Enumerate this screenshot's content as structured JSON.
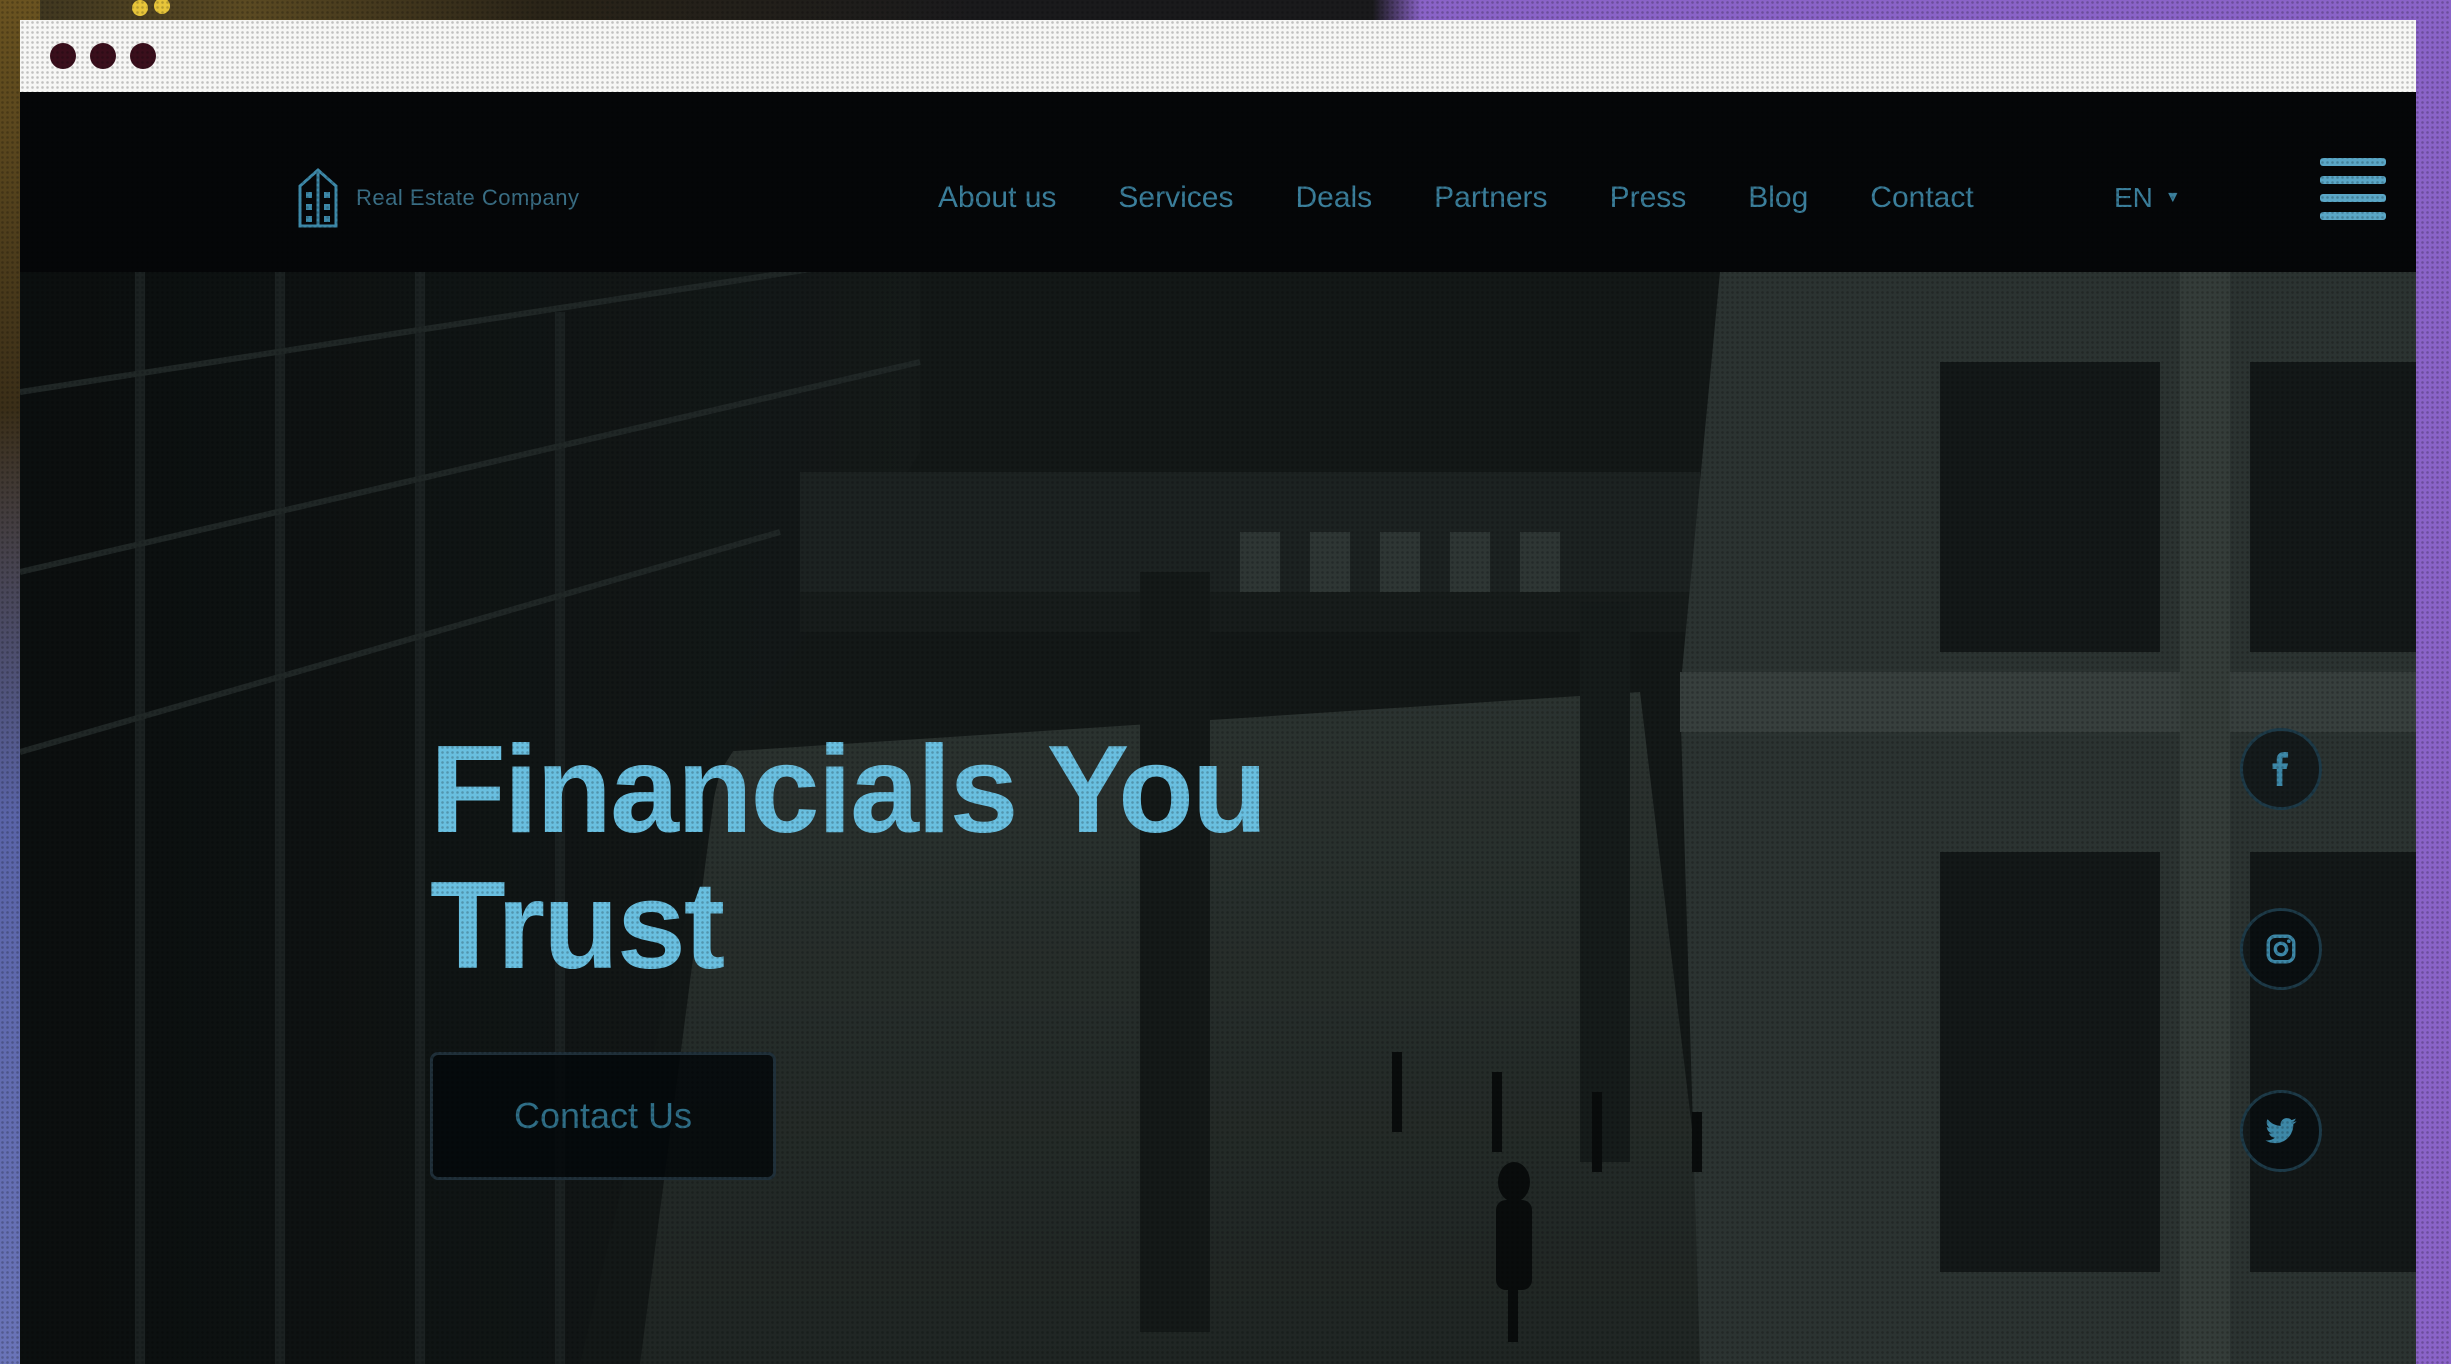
{
  "logo": {
    "text": "Real Estate Company"
  },
  "nav": {
    "items": [
      "About us",
      "Services",
      "Deals",
      "Partners",
      "Press",
      "Blog",
      "Contact"
    ],
    "language": "EN"
  },
  "hero": {
    "title_line1": "Financials You",
    "title_line2": "Trust",
    "cta_label": "Contact Us"
  },
  "social": [
    "facebook-icon",
    "instagram-icon",
    "twitter-icon"
  ],
  "colors": {
    "accent": "#69bfe0",
    "nav_text": "#3b7f9c",
    "header_bg": "#050608",
    "frame_purple": "#8a63c8",
    "titlebar": "#f7f7f5",
    "window_dots": "#3a0f1c"
  }
}
